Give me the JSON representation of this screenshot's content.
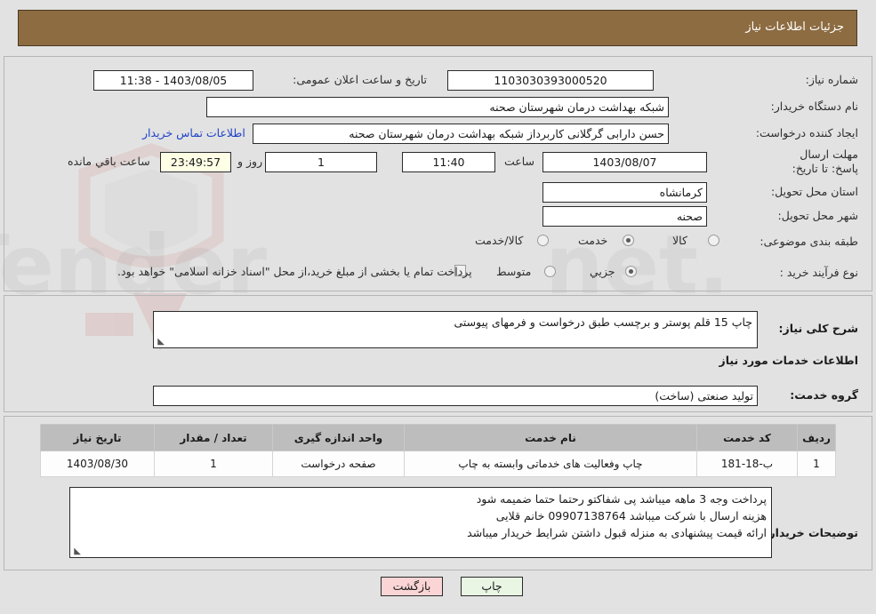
{
  "header": {
    "title": "جزئیات اطلاعات نیاز"
  },
  "fields": {
    "need_number_label": "شماره نیاز:",
    "need_number_value": "1103030393000520",
    "announce_label": "تاریخ و ساعت اعلان عمومی:",
    "announce_value": "1403/08/05 - 11:38",
    "buyer_org_label": "نام دستگاه خریدار:",
    "buyer_org_value": "شبکه بهداشت درمان شهرستان صحنه",
    "creator_label": "ایجاد کننده درخواست:",
    "creator_value": "حسن دارابی گرگلانی کاربرداز شبکه بهداشت درمان شهرستان صحنه",
    "contact_link": "اطلاعات تماس خریدار",
    "deadline_label": "مهلت ارسال پاسخ: تا تاریخ:",
    "deadline_date": "1403/08/07",
    "hour_label": "ساعت",
    "deadline_time": "11:40",
    "days_value": "1",
    "days_label": "روز و",
    "countdown_value": "23:49:57",
    "remaining_label": "ساعت باقي مانده",
    "province_label": "استان محل تحویل:",
    "province_value": "کرمانشاه",
    "city_label": "شهر محل تحویل:",
    "city_value": "صحنه",
    "classification_label": "طبقه بندی موضوعی:",
    "process_label": "نوع فرآیند خرید :",
    "treasury_note": "پرداخت تمام یا بخشی از مبلغ خرید،از محل \"اسناد خزانه اسلامی\" خواهد بود."
  },
  "classification_options": [
    {
      "label": "کالا",
      "selected": false
    },
    {
      "label": "خدمت",
      "selected": true
    },
    {
      "label": "کالا/خدمت",
      "selected": false
    }
  ],
  "process_options": [
    {
      "label": "جزیي",
      "selected": true
    },
    {
      "label": "متوسط",
      "selected": false
    }
  ],
  "treasury_checkbox": {
    "checked": false
  },
  "description": {
    "label": "شرح کلی نیاز:",
    "value": "چاپ 15 قلم پوستر و برچسب طبق درخواست و فرمهای پیوستی",
    "section_title": "اطلاعات خدمات مورد نیاز",
    "service_group_label": "گروه خدمت:",
    "service_group_value": "تولید صنعتی (ساخت)"
  },
  "table": {
    "columns": [
      "ردیف",
      "کد خدمت",
      "نام خدمت",
      "واحد اندازه گیری",
      "تعداد / مقدار",
      "تاریخ نیاز"
    ],
    "rows": [
      {
        "row": "1",
        "code": "ب-18-181",
        "name": "چاپ وفعالیت های خدماتی وابسته به چاپ",
        "unit": "صفحه درخواست",
        "qty": "1",
        "date": "1403/08/30"
      }
    ]
  },
  "comments": {
    "label": "توضیحات خریدار:",
    "line1": "پرداخت وجه 3 ماهه میباشد پی شفاکتو رحتما حتما ضمیمه شود",
    "line2": "هزینه ارسال با شرکت میباشد   09907138764  خانم قلایی",
    "line3": "ارائه قیمت پیشنهادی به منزله قبول داشتن شرایط خریدار میباشد"
  },
  "footer": {
    "print_label": "چاپ",
    "back_label": "بازگشت"
  },
  "watermark": {
    "text": "AriaTender.net"
  },
  "colors": {
    "header_bg": "#8d6c42",
    "page_bg": "#e2e2e2",
    "link": "#1f42c8",
    "timer_bg": "#ffffe6",
    "print_btn_bg": "#e8f6e3",
    "back_btn_bg": "#fbd5d5"
  }
}
